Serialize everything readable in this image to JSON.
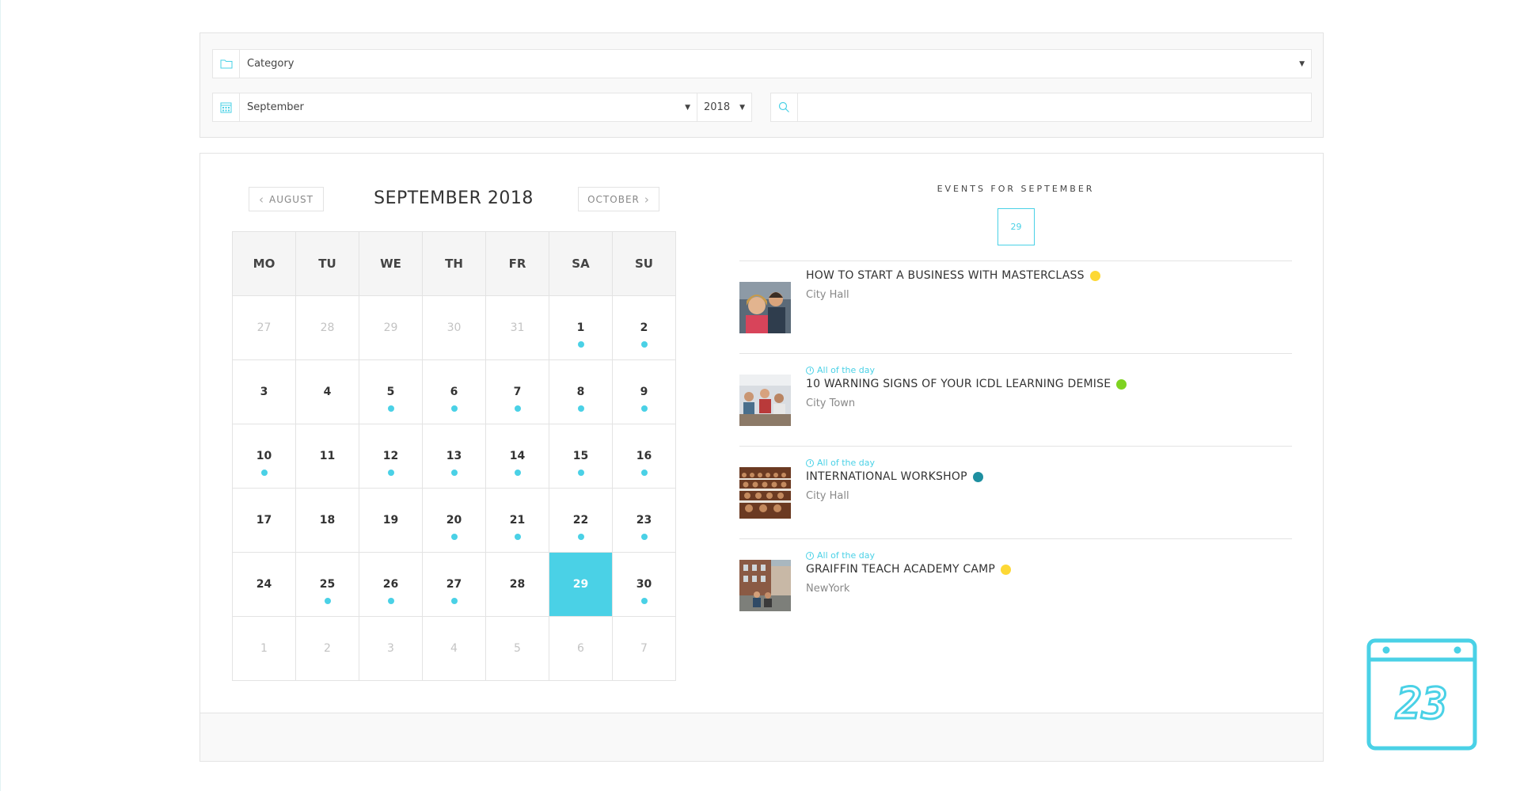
{
  "filters": {
    "category": {
      "value": "Category",
      "icon": "folder-icon"
    },
    "month": {
      "value": "September",
      "icon": "calendar-icon"
    },
    "year": {
      "value": "2018"
    },
    "search": {
      "value": "",
      "placeholder": "",
      "icon": "search-icon"
    }
  },
  "calendar": {
    "title": "SEPTEMBER 2018",
    "prev_label": "AUGUST",
    "next_label": "OCTOBER",
    "weekdays": [
      "MO",
      "TU",
      "WE",
      "TH",
      "FR",
      "SA",
      "SU"
    ],
    "weeks": [
      [
        {
          "day": "27",
          "other": true,
          "event": false
        },
        {
          "day": "28",
          "other": true,
          "event": false
        },
        {
          "day": "29",
          "other": true,
          "event": false
        },
        {
          "day": "30",
          "other": true,
          "event": false
        },
        {
          "day": "31",
          "other": true,
          "event": false
        },
        {
          "day": "1",
          "other": false,
          "event": true
        },
        {
          "day": "2",
          "other": false,
          "event": true
        }
      ],
      [
        {
          "day": "3",
          "other": false,
          "event": false
        },
        {
          "day": "4",
          "other": false,
          "event": false
        },
        {
          "day": "5",
          "other": false,
          "event": true
        },
        {
          "day": "6",
          "other": false,
          "event": true
        },
        {
          "day": "7",
          "other": false,
          "event": true
        },
        {
          "day": "8",
          "other": false,
          "event": true
        },
        {
          "day": "9",
          "other": false,
          "event": true
        }
      ],
      [
        {
          "day": "10",
          "other": false,
          "event": true
        },
        {
          "day": "11",
          "other": false,
          "event": false
        },
        {
          "day": "12",
          "other": false,
          "event": true
        },
        {
          "day": "13",
          "other": false,
          "event": true
        },
        {
          "day": "14",
          "other": false,
          "event": true
        },
        {
          "day": "15",
          "other": false,
          "event": true
        },
        {
          "day": "16",
          "other": false,
          "event": true
        }
      ],
      [
        {
          "day": "17",
          "other": false,
          "event": false
        },
        {
          "day": "18",
          "other": false,
          "event": false
        },
        {
          "day": "19",
          "other": false,
          "event": false
        },
        {
          "day": "20",
          "other": false,
          "event": true
        },
        {
          "day": "21",
          "other": false,
          "event": true
        },
        {
          "day": "22",
          "other": false,
          "event": true
        },
        {
          "day": "23",
          "other": false,
          "event": true
        }
      ],
      [
        {
          "day": "24",
          "other": false,
          "event": false
        },
        {
          "day": "25",
          "other": false,
          "event": true
        },
        {
          "day": "26",
          "other": false,
          "event": true
        },
        {
          "day": "27",
          "other": false,
          "event": true
        },
        {
          "day": "28",
          "other": false,
          "event": false
        },
        {
          "day": "29",
          "other": false,
          "event": false,
          "selected": true
        },
        {
          "day": "30",
          "other": false,
          "event": true
        }
      ],
      [
        {
          "day": "1",
          "other": true,
          "event": false
        },
        {
          "day": "2",
          "other": true,
          "event": false
        },
        {
          "day": "3",
          "other": true,
          "event": false
        },
        {
          "day": "4",
          "other": true,
          "event": false
        },
        {
          "day": "5",
          "other": true,
          "event": false
        },
        {
          "day": "6",
          "other": true,
          "event": false
        },
        {
          "day": "7",
          "other": true,
          "event": false
        }
      ]
    ]
  },
  "events_panel": {
    "header": "EVENTS FOR SEPTEMBER",
    "selected_day": "29",
    "events": [
      {
        "time": "",
        "title": "HOW TO START A BUSINESS WITH MASTERCLASS",
        "venue": "City Hall",
        "dot_color": "#fdd835",
        "thumb": "students-photo"
      },
      {
        "time": "All of the day",
        "title": "10 WARNING SIGNS OF YOUR ICDL LEARNING DEMISE",
        "venue": "City Town",
        "dot_color": "#7ed321",
        "thumb": "classroom-photo"
      },
      {
        "time": "All of the day",
        "title": "INTERNATIONAL WORKSHOP",
        "venue": "City Hall",
        "dot_color": "#1e8fa0",
        "thumb": "lecture-hall-photo"
      },
      {
        "time": "All of the day",
        "title": "GRAIFFIN TEACH ACADEMY CAMP",
        "venue": "NewYork",
        "dot_color": "#fdd835",
        "thumb": "campus-photo"
      }
    ]
  },
  "floating_icon": {
    "label": "23",
    "icon": "calendar-23-icon"
  },
  "colors": {
    "accent": "#4ad1e6",
    "border": "#e3e3e3",
    "panel_bg": "#f9f9f9"
  }
}
